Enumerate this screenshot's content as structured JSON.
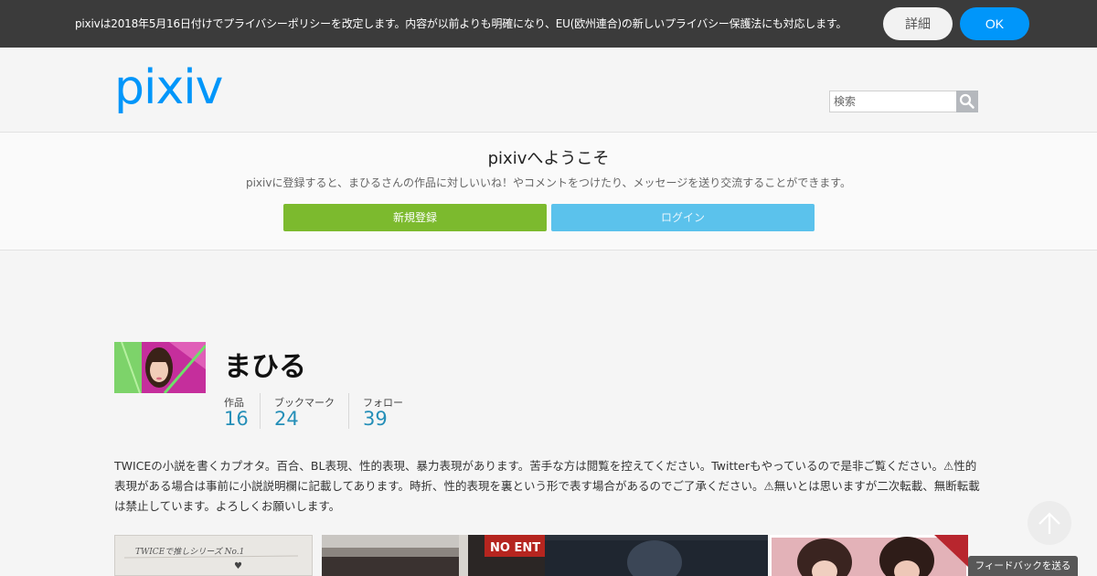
{
  "notice": {
    "text": "pixivは2018年5月16日付けでプライバシーポリシーを改定します。内容が以前よりも明確になり、EU(欧州連合)の新しいプライバシー保護法にも対応します。",
    "detail_label": "詳細",
    "ok_label": "OK"
  },
  "header": {
    "logo_text": "pixiv",
    "search_placeholder": "検索",
    "search_icon": "search-icon"
  },
  "welcome": {
    "title": "pixivへようこそ",
    "description": "pixivに登録すると、まひるさんの作品に対しいいね！やコメントをつけたり、メッセージを送り交流することができます。",
    "signup_label": "新規登録",
    "login_label": "ログイン"
  },
  "profile": {
    "name": "まひる",
    "stats": [
      {
        "label": "作品",
        "value": "16"
      },
      {
        "label": "ブックマーク",
        "value": "24"
      },
      {
        "label": "フォロー",
        "value": "39"
      }
    ],
    "bio": "TWICEの小説を書くカプオタ。百合、BL表現、性的表現、暴力表現があります。苦手な方は閲覧を控えてください。Twitterもやっているので是非ご覧ください。⚠性的表現がある場合は事前に小説説明欄に記載してあります。時折、性的表現を裏という形で表す場合があるのでご了承ください。⚠無いとは思いますが二次転載、無断転載は禁止しています。よろしくお願いします。"
  },
  "thumbnails": {
    "thumb1_text": "TWICEで推しシリーズ No.1",
    "thumb2_text": "NO ENT"
  },
  "floating": {
    "scroll_top_icon": "arrow-up-icon",
    "feedback_label": "フィードバックを送る"
  },
  "colors": {
    "brand": "#0096fa",
    "signup_green": "#7cba2e",
    "login_blue": "#5bc2ec",
    "stat_value": "#258fb8",
    "notice_bg": "#3b3b3b"
  }
}
